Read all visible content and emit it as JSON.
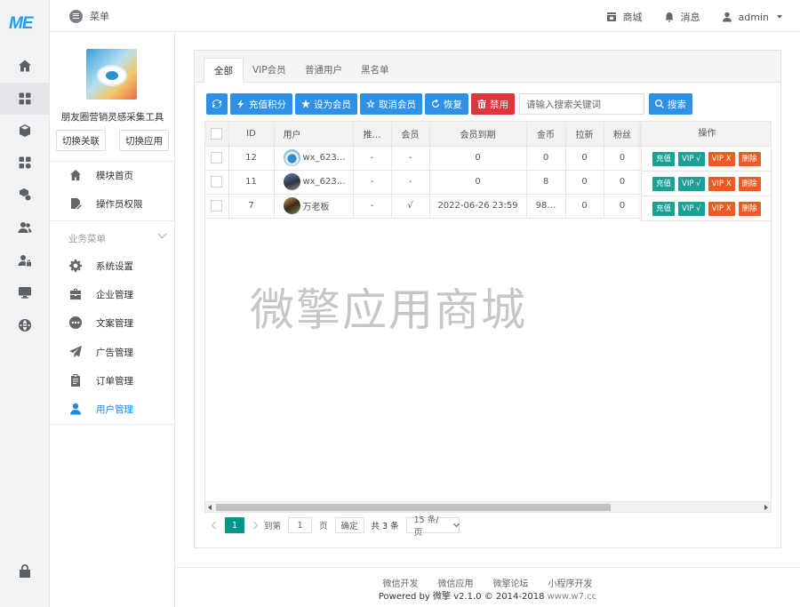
{
  "logo_text": "ME",
  "topbar": {
    "menu_label": "菜单",
    "store_label": "商城",
    "messages_label": "消息",
    "user_label": "admin"
  },
  "sidebar": {
    "app_name": "朋友圈营销灵感采集工具",
    "switch_relation_label": "切换关联",
    "switch_app_label": "切换应用",
    "top_items": [
      {
        "label": "模块首页",
        "icon": "home-icon"
      },
      {
        "label": "操作员权限",
        "icon": "edit-icon"
      }
    ],
    "group_title": "业务菜单",
    "group_items": [
      {
        "label": "系统设置",
        "icon": "gear-icon"
      },
      {
        "label": "企业管理",
        "icon": "briefcase-icon"
      },
      {
        "label": "文案管理",
        "icon": "more-dots-icon"
      },
      {
        "label": "广告管理",
        "icon": "paper-plane-icon"
      },
      {
        "label": "订单管理",
        "icon": "clipboard-icon"
      },
      {
        "label": "用户管理",
        "icon": "user-icon"
      }
    ]
  },
  "tabs": [
    "全部",
    "VIP会员",
    "普通用户",
    "黑名单"
  ],
  "toolbar": {
    "recharge_points_label": "充值积分",
    "set_member_label": "设为会员",
    "cancel_member_label": "取消会员",
    "restore_label": "恢复",
    "ban_label": "禁用",
    "search_placeholder": "请输入搜索关键词",
    "search_label": "搜索"
  },
  "table": {
    "headers": [
      "ID",
      "用户",
      "推…",
      "会员",
      "会员到期",
      "金币",
      "拉新",
      "粉丝"
    ],
    "op_header": "操作",
    "rows": [
      {
        "id": "12",
        "user": "wx_623…",
        "referrer": "-",
        "member": "-",
        "expire": "0",
        "coins": "0",
        "invites": "0",
        "fans": "0"
      },
      {
        "id": "11",
        "user": "wx_623…",
        "referrer": "-",
        "member": "-",
        "expire": "0",
        "coins": "8",
        "invites": "0",
        "fans": "0"
      },
      {
        "id": "7",
        "user": "万老板",
        "referrer": "-",
        "member": "√",
        "expire": "2022-06-26 23:59",
        "coins": "98…",
        "invites": "0",
        "fans": "0"
      }
    ],
    "row_actions": {
      "recharge": "充值",
      "vip_on": "VIP √",
      "vip_off": "VIP X",
      "delete": "删除"
    }
  },
  "pagination": {
    "current_page": "1",
    "goto_label": "到第",
    "page_input": "1",
    "page_label": "页",
    "confirm_label": "确定",
    "total_label": "共 3 条",
    "page_size_label": "15 条/页"
  },
  "watermark": "微擎应用商城",
  "footer": {
    "links": [
      "微信开发",
      "微信应用",
      "微擎论坛",
      "小程序开发"
    ],
    "powered_prefix": "Powered by",
    "brand": "微擎",
    "version": "v2.1.0 © 2014-2018",
    "site": "www.w7.cc"
  },
  "colors": {
    "primary": "#2f91e6",
    "danger": "#e0353c",
    "teal": "#1aa094",
    "orange": "#f05a22",
    "pager_active": "#009688"
  }
}
